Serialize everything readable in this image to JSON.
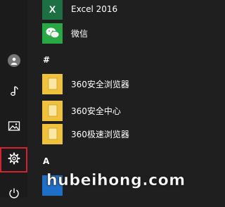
{
  "rail": {
    "items": [
      {
        "name": "user",
        "icon": "user-icon"
      },
      {
        "name": "documents",
        "icon": "document-icon"
      },
      {
        "name": "pictures",
        "icon": "pictures-icon"
      },
      {
        "name": "settings",
        "icon": "gear-icon",
        "highlighted": true
      },
      {
        "name": "power",
        "icon": "power-icon"
      }
    ],
    "highlight_color": "#d3232f"
  },
  "apps": {
    "excel": {
      "label": "Excel 2016",
      "tile_color": "#1d7044",
      "tile_text": "X"
    },
    "wechat": {
      "label": "微信",
      "tile_color": "#28a745"
    },
    "group_hash": "#",
    "browser360": {
      "label": "360安全浏览器"
    },
    "center360": {
      "label": "360安全中心"
    },
    "speed360": {
      "label": "360极速浏览器"
    },
    "group_a": "A"
  },
  "watermark": {
    "text": "hubeihong.com"
  }
}
